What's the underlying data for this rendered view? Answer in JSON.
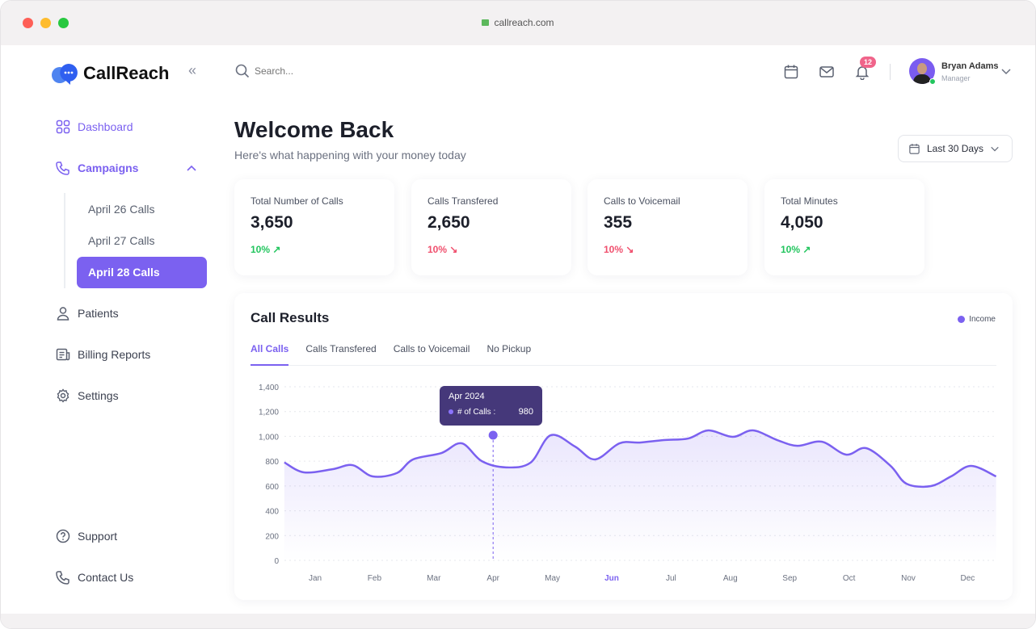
{
  "browser": {
    "url": "callreach.com"
  },
  "brand": {
    "name": "CallReach",
    "accent": "#7b61f0"
  },
  "header": {
    "search_placeholder": "Search...",
    "notification_count": "12",
    "user": {
      "name": "Bryan Adams",
      "role": "Manager"
    }
  },
  "sidebar": {
    "items": [
      {
        "label": "Dashboard",
        "icon": "grid-icon"
      },
      {
        "label": "Campaigns",
        "icon": "phone-icon"
      },
      {
        "label": "Patients",
        "icon": "user-icon"
      },
      {
        "label": "Billing Reports",
        "icon": "report-icon"
      },
      {
        "label": "Settings",
        "icon": "gear-icon"
      }
    ],
    "campaign_children": [
      "April 26 Calls",
      "April 27 Calls",
      "April 28 Calls"
    ],
    "footer": [
      {
        "label": "Support",
        "icon": "help-icon"
      },
      {
        "label": "Contact Us",
        "icon": "phone-icon"
      }
    ]
  },
  "main": {
    "title": "Welcome Back",
    "subtitle": "Here's what happening with your money today",
    "range": "Last 30 Days",
    "stats": [
      {
        "label": "Total Number of Calls",
        "value": "3,650",
        "change": "10%",
        "trend": "up"
      },
      {
        "label": "Calls Transfered",
        "value": "2,650",
        "change": "10%",
        "trend": "down"
      },
      {
        "label": "Calls to Voicemail",
        "value": "355",
        "change": "10%",
        "trend": "down"
      },
      {
        "label": "Total Minutes",
        "value": "4,050",
        "change": "10%",
        "trend": "up"
      }
    ],
    "panel": {
      "title": "Call Results",
      "legend": "Income",
      "tabs": [
        "All Calls",
        "Calls Transfered",
        "Calls to Voicemail",
        "No Pickup"
      ],
      "tooltip": {
        "title": "Apr  2024",
        "label": "# of Calls  :",
        "value": "980"
      }
    }
  },
  "chart_data": {
    "type": "area",
    "categories": [
      "Jan",
      "Feb",
      "Mar",
      "Apr",
      "May",
      "Jun",
      "Jul",
      "Aug",
      "Sep",
      "Oct",
      "Nov",
      "Dec"
    ],
    "highlighted_category": "Jun",
    "yticks": [
      "0",
      "200",
      "400",
      "600",
      "800",
      "1,000",
      "1,200",
      "1,400"
    ],
    "ylim": [
      0,
      1400
    ],
    "grid": true,
    "color": "#7b61f0",
    "series": [
      {
        "name": "Income",
        "points": [
          [
            0.48,
            790
          ],
          [
            0.81,
            710
          ],
          [
            1.29,
            735
          ],
          [
            1.63,
            768
          ],
          [
            1.97,
            677
          ],
          [
            2.38,
            705
          ],
          [
            2.65,
            814
          ],
          [
            3.13,
            866
          ],
          [
            3.47,
            944
          ],
          [
            3.81,
            800
          ],
          [
            4.22,
            750
          ],
          [
            4.63,
            788
          ],
          [
            4.97,
            1009
          ],
          [
            5.38,
            918
          ],
          [
            5.72,
            814
          ],
          [
            6.13,
            944
          ],
          [
            6.47,
            950
          ],
          [
            6.88,
            970
          ],
          [
            7.29,
            983
          ],
          [
            7.63,
            1048
          ],
          [
            8.04,
            996
          ],
          [
            8.38,
            1048
          ],
          [
            8.79,
            970
          ],
          [
            9.13,
            924
          ],
          [
            9.54,
            957
          ],
          [
            9.95,
            853
          ],
          [
            10.29,
            905
          ],
          [
            10.7,
            762
          ],
          [
            10.97,
            618
          ],
          [
            11.38,
            599
          ],
          [
            11.72,
            677
          ],
          [
            12.06,
            762
          ],
          [
            12.48,
            677
          ]
        ]
      }
    ],
    "tooltip_x": "Apr",
    "tooltip_value": 980
  }
}
